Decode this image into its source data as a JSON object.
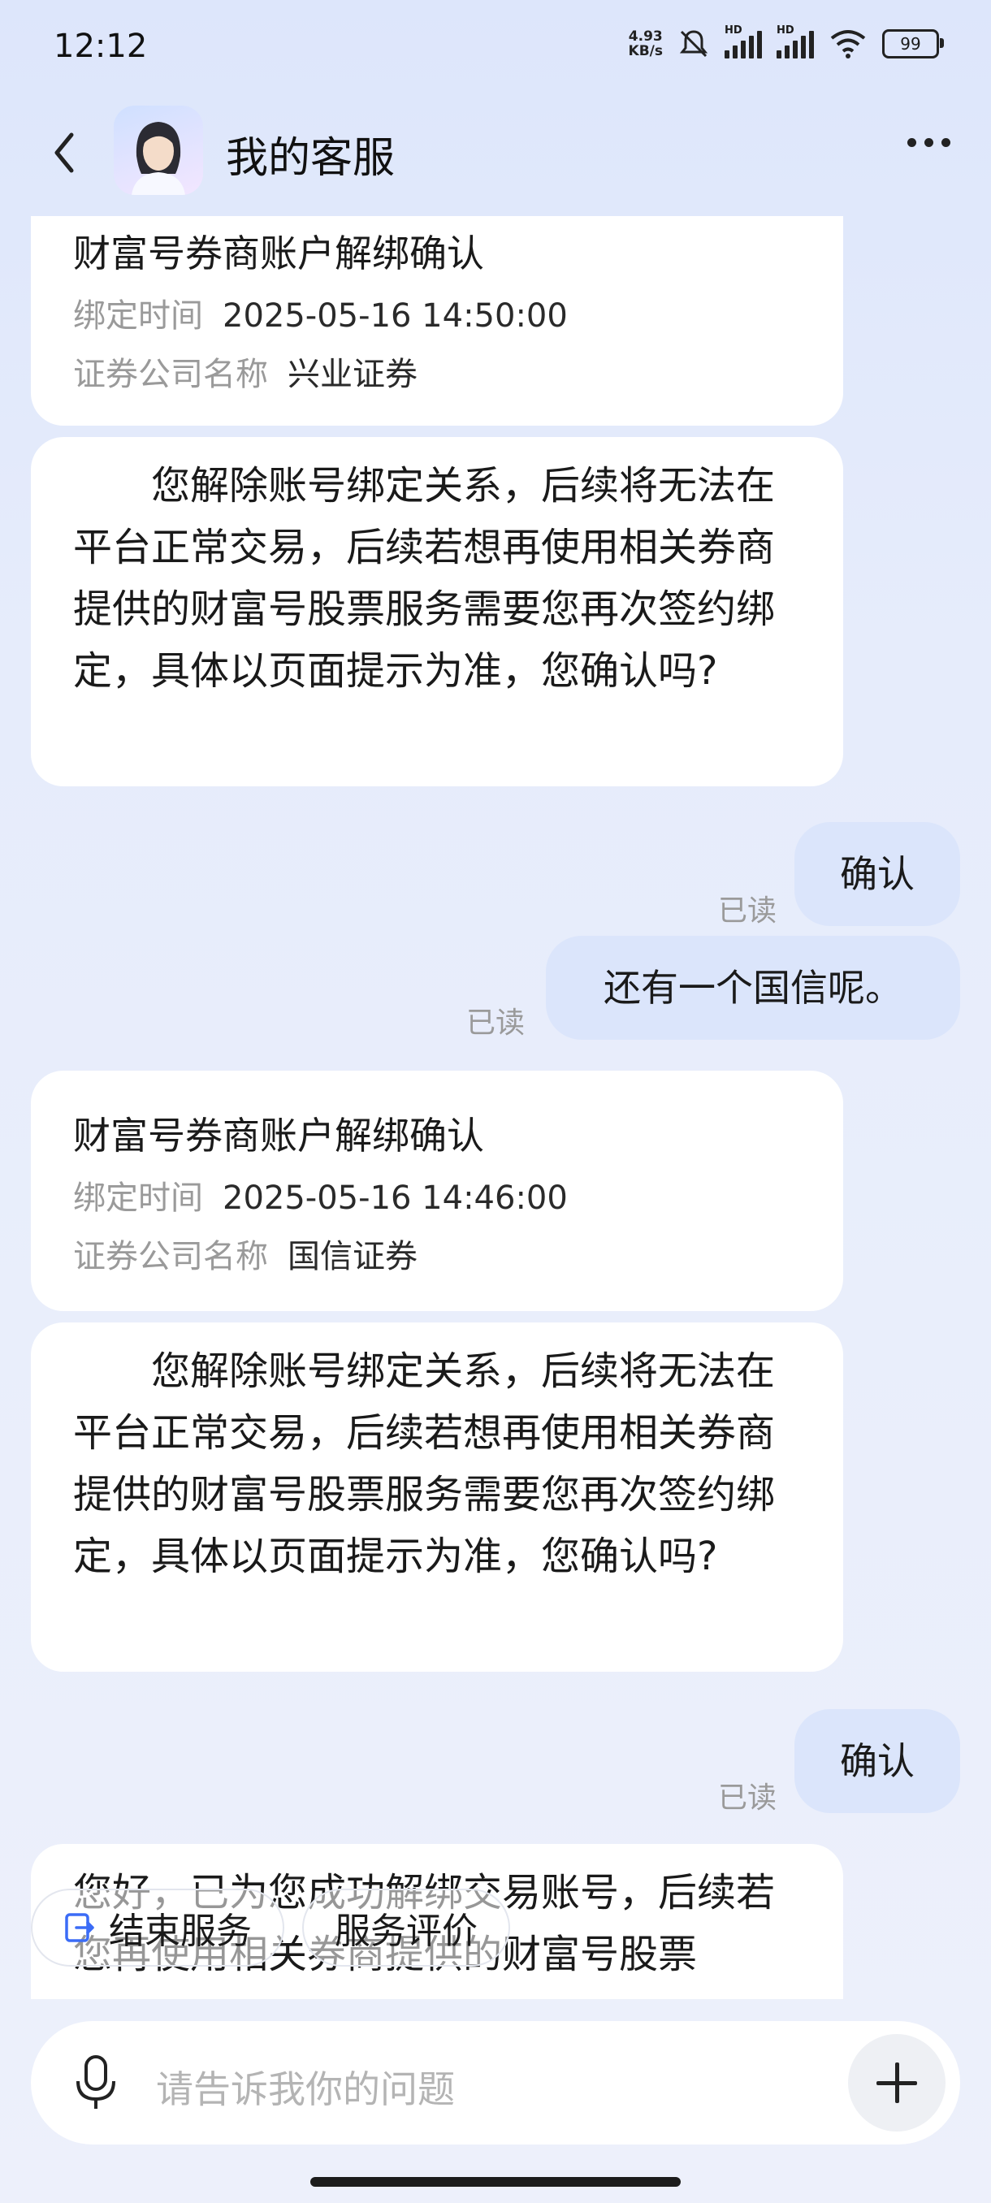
{
  "status": {
    "time": "12:12",
    "netspeed_value": "4.93",
    "netspeed_unit": "KB/s",
    "hd1": "HD",
    "hd2": "HD",
    "battery": "99"
  },
  "header": {
    "title": "我的客服",
    "back_icon": "chevron-left-icon",
    "more_icon": "more-dots-icon"
  },
  "messages": {
    "card1": {
      "title": "财富号券商账户解绑确认",
      "k1": "绑定时间",
      "v1": "2025-05-16 14:50:00",
      "k2": "证券公司名称",
      "v2": "兴业证券"
    },
    "para1": "您解除账号绑定关系，后续将无法在平台正常交易，后续若想再使用相关券商提供的财富号股票服务需要您再次签约绑定，具体以页面提示为准，您确认吗?",
    "me1": "确认",
    "read1": "已读",
    "me2": "还有一个国信呢。",
    "read2": "已读",
    "card2": {
      "title": "财富号券商账户解绑确认",
      "k1": "绑定时间",
      "v1": "2025-05-16 14:46:00",
      "k2": "证券公司名称",
      "v2": "国信证券"
    },
    "para2": "您解除账号绑定关系，后续将无法在平台正常交易，后续若想再使用相关券商提供的财富号股票服务需要您再次签约绑定，具体以页面提示为准，您确认吗?",
    "me3": "确认",
    "read3": "已读",
    "para3": "您好，已为您成功解绑交易账号，后续若您再使用相关券商提供的财富号股票"
  },
  "chips": {
    "end": "结束服务",
    "rate": "服务评价"
  },
  "input": {
    "placeholder": "请告诉我你的问题"
  }
}
